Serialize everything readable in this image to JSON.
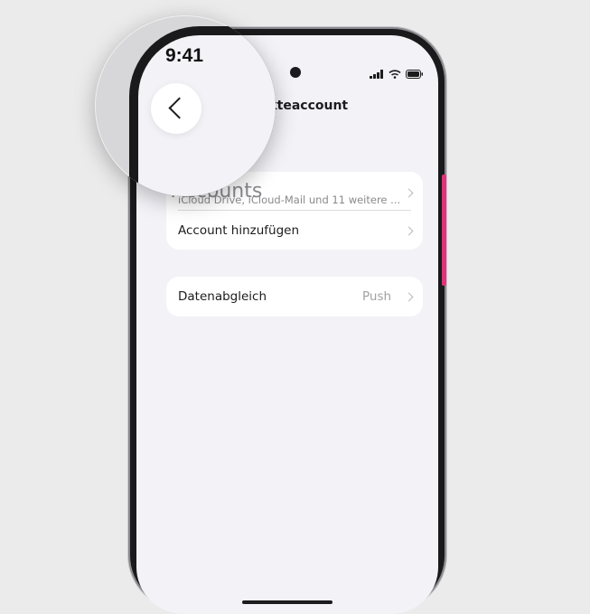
{
  "status_bar": {
    "time": "9:41",
    "icons": [
      "cellular-signal-icon",
      "wifi-icon",
      "battery-icon"
    ]
  },
  "nav": {
    "back_icon": "chevron-left-icon",
    "title": "Kontakteaccount"
  },
  "accounts_section": {
    "heading": "Accounts",
    "subtitle": "iCloud Drive, iCloud-Mail und 11 weitere ...",
    "add_account_label": "Account hinzufügen"
  },
  "sync_section": {
    "label": "Datenabgleich",
    "value": "Push"
  },
  "colors": {
    "background": "#ebebeb",
    "screen": "#f2f2f7",
    "card": "#ffffff",
    "side_button_accent": "#e0337a",
    "secondary_text": "#8a8a8e"
  }
}
